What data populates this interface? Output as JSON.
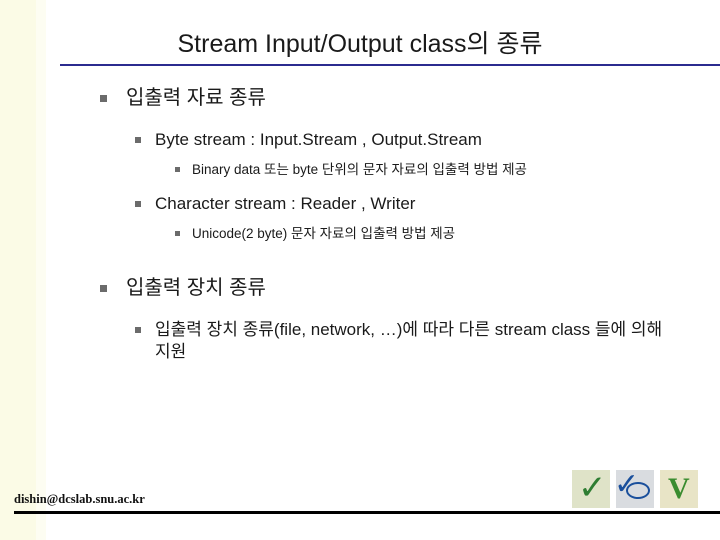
{
  "slide": {
    "title": "Stream Input/Output class의 종류",
    "sections": [
      {
        "level1": "입출력 자료 종류",
        "children": [
          {
            "level2": "Byte stream : Input.Stream , Output.Stream",
            "children": [
              {
                "level3": "Binary data 또는 byte 단위의 문자 자료의 입출력 방법 제공"
              }
            ]
          },
          {
            "level2": "Character stream : Reader , Writer",
            "children": [
              {
                "level3": "Unicode(2 byte) 문자 자료의 입출력 방법 제공"
              }
            ]
          }
        ]
      },
      {
        "level1": "입출력 장치 종류",
        "children": [
          {
            "level2": "입출력 장치 종류(file, network, …)에 따라 다른 stream class 들에 의해 지원",
            "children": []
          }
        ]
      }
    ],
    "footer": {
      "email": "dishin@dcslab.snu.ac.kr"
    },
    "logos": [
      {
        "name": "check-mark-green",
        "glyph": "✓"
      },
      {
        "name": "oval-blue",
        "glyph": ""
      },
      {
        "name": "letter-v-green",
        "glyph": "V"
      }
    ],
    "colors": {
      "title_rule": "#2b2b8f",
      "band": "#fbfbe6",
      "bullet": "#6b6b6b"
    }
  }
}
